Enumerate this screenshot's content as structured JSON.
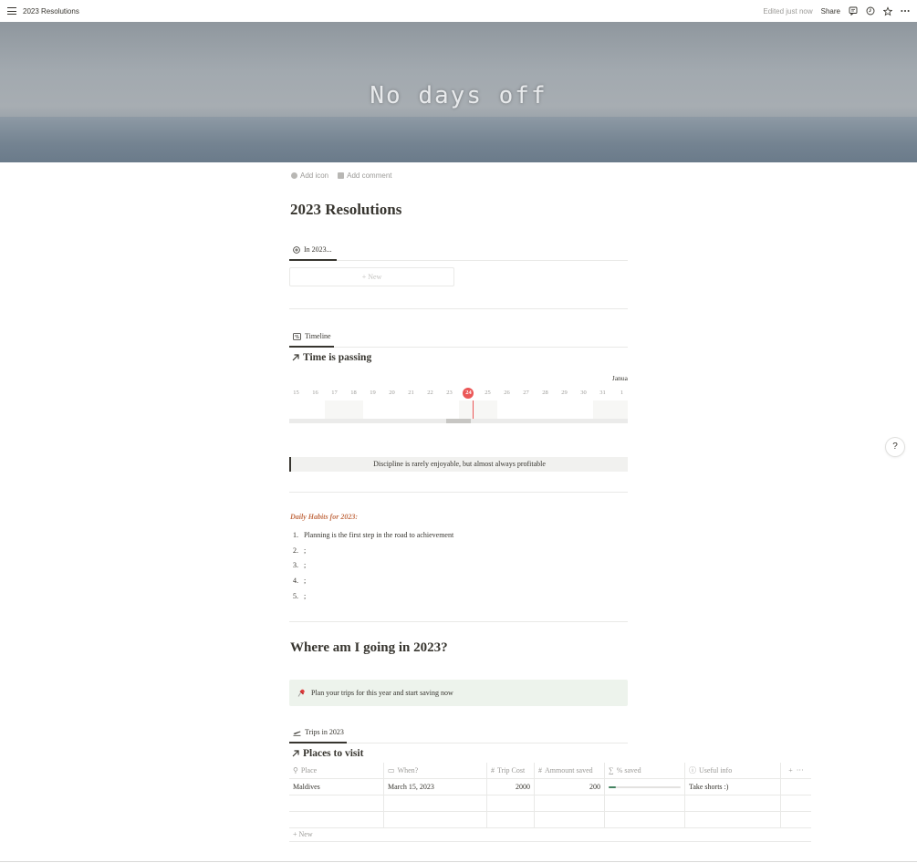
{
  "topbar": {
    "title": "2023 Resolutions",
    "edited": "Edited just now",
    "share": "Share",
    "icons": [
      "menu-icon",
      "comment-icon",
      "clock-icon",
      "star-icon",
      "more-icon"
    ]
  },
  "cover": {
    "text": "No days off"
  },
  "add_bar": {
    "add_icon": "Add icon",
    "add_comment": "Add comment"
  },
  "page": {
    "title": "2023 Resolutions"
  },
  "gallery": {
    "tab_label": "In 2023...",
    "new_label": "+ New"
  },
  "timeline": {
    "tab_label": "Timeline",
    "title": "Time is passing",
    "month": "Janua",
    "days": [
      "15",
      "16",
      "17",
      "18",
      "19",
      "20",
      "21",
      "22",
      "23",
      "24",
      "25",
      "26",
      "27",
      "28",
      "29",
      "30",
      "31",
      "1"
    ],
    "today": "24"
  },
  "quote": {
    "text": "Discipline is rarely enjoyable, but almost always profitable"
  },
  "habits": {
    "title": "Daily Habits for 2023:",
    "items": [
      {
        "num": "1.",
        "text": "Planning is the first step in the road to achievement"
      },
      {
        "num": "2.",
        "text": ";"
      },
      {
        "num": "3.",
        "text": ";"
      },
      {
        "num": "4.",
        "text": ";"
      },
      {
        "num": "5.",
        "text": ";"
      }
    ]
  },
  "trips": {
    "heading": "Where am I going in 2023?",
    "callout": "Plan your trips for this year  and start saving now",
    "callout_icon": "pushpin-icon",
    "tab_label": "Trips in 2023",
    "title": "Places to visit",
    "columns": [
      "Place",
      "When?",
      "Trip Cost",
      "Ammount saved",
      "% saved",
      "Useful info"
    ],
    "rows": [
      {
        "place": "Maldives",
        "when": "March 15, 2023",
        "cost": "2000",
        "saved": "200",
        "percent": 0.1,
        "info": "Take shorts :)"
      }
    ],
    "new_label": "New",
    "add_symbol": "+",
    "more_symbol": "···"
  },
  "help": {
    "label": "?"
  },
  "colors": {
    "accent_red": "#eb5757",
    "callout_bg": "#edf3ec",
    "habits_title": "#c4704a",
    "progress": "#448361"
  }
}
